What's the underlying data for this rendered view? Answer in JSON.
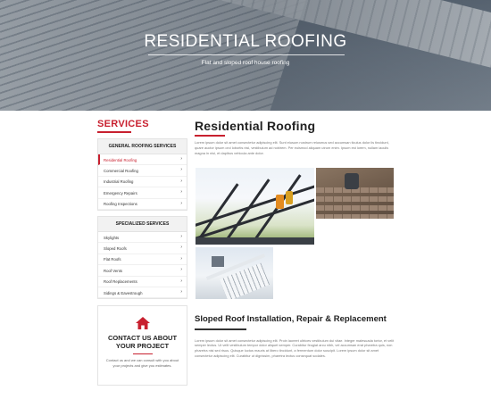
{
  "hero": {
    "title": "RESIDENTIAL ROOFING",
    "subtitle": "Flat and sloped roof house roofing"
  },
  "sidebar": {
    "heading": "SERVICES",
    "general": {
      "title": "GENERAL ROOFING SERVICES",
      "items": [
        {
          "label": "Residential Roofing",
          "active": true
        },
        {
          "label": "Commercial Roofing"
        },
        {
          "label": "Industrial Roofing"
        },
        {
          "label": "Emergency Repairs"
        },
        {
          "label": "Roofing Inspections"
        }
      ]
    },
    "specialized": {
      "title": "SPECIALIZED SERVICES",
      "items": [
        {
          "label": "Skylights"
        },
        {
          "label": "Sloped Roofs"
        },
        {
          "label": "Flat Roofs"
        },
        {
          "label": "Roof Vents"
        },
        {
          "label": "Roof Replacements"
        },
        {
          "label": "Sidings & Eavestrough"
        }
      ]
    },
    "contact": {
      "title": "CONTACT US ABOUT YOUR PROJECT",
      "text": "Contact us and we can consult with you about your projects and give you estimates."
    }
  },
  "main": {
    "title": "Residential Roofing",
    "intro": "Lorem ipsum dolor sit amet consectetur adipiscing elit. Sunt eiusum nostrum reiusmus sed accumsan ticulus dolor iis tincidunt, quare auctor ipsum orci lobortis nisl, vestibulum ad nobirem. Per euismod aliquam utrum enim. Ipsum est lorem, nullam iaculis magna in nisi, et dapibus vehicula ante dolor.",
    "section2_title": "Sloped Roof Installation, Repair & Replacement",
    "section2_text": "Lorem ipsum dolor sit amet consectetur adipiscing elit. Proin laoreet ultrices vestibulum dui vitae. Integer malesuada tortor, et velit semper lectus. Ut velit vestibulum tempor dolor aliquet semper. Curabitur feugiat arcu nibh, vel accumsan erat pharetra quis, non pharetra nisi sed risus. Quisque luctus mauris at libero tincidunt, a fermentum dolor suscipit. Lorem ipsum dolor sit amet consectetur adipiscing elit. Curabitur ut dignissim, pharetra lectus consequat sodales."
  },
  "colors": {
    "accent": "#c8202f"
  }
}
